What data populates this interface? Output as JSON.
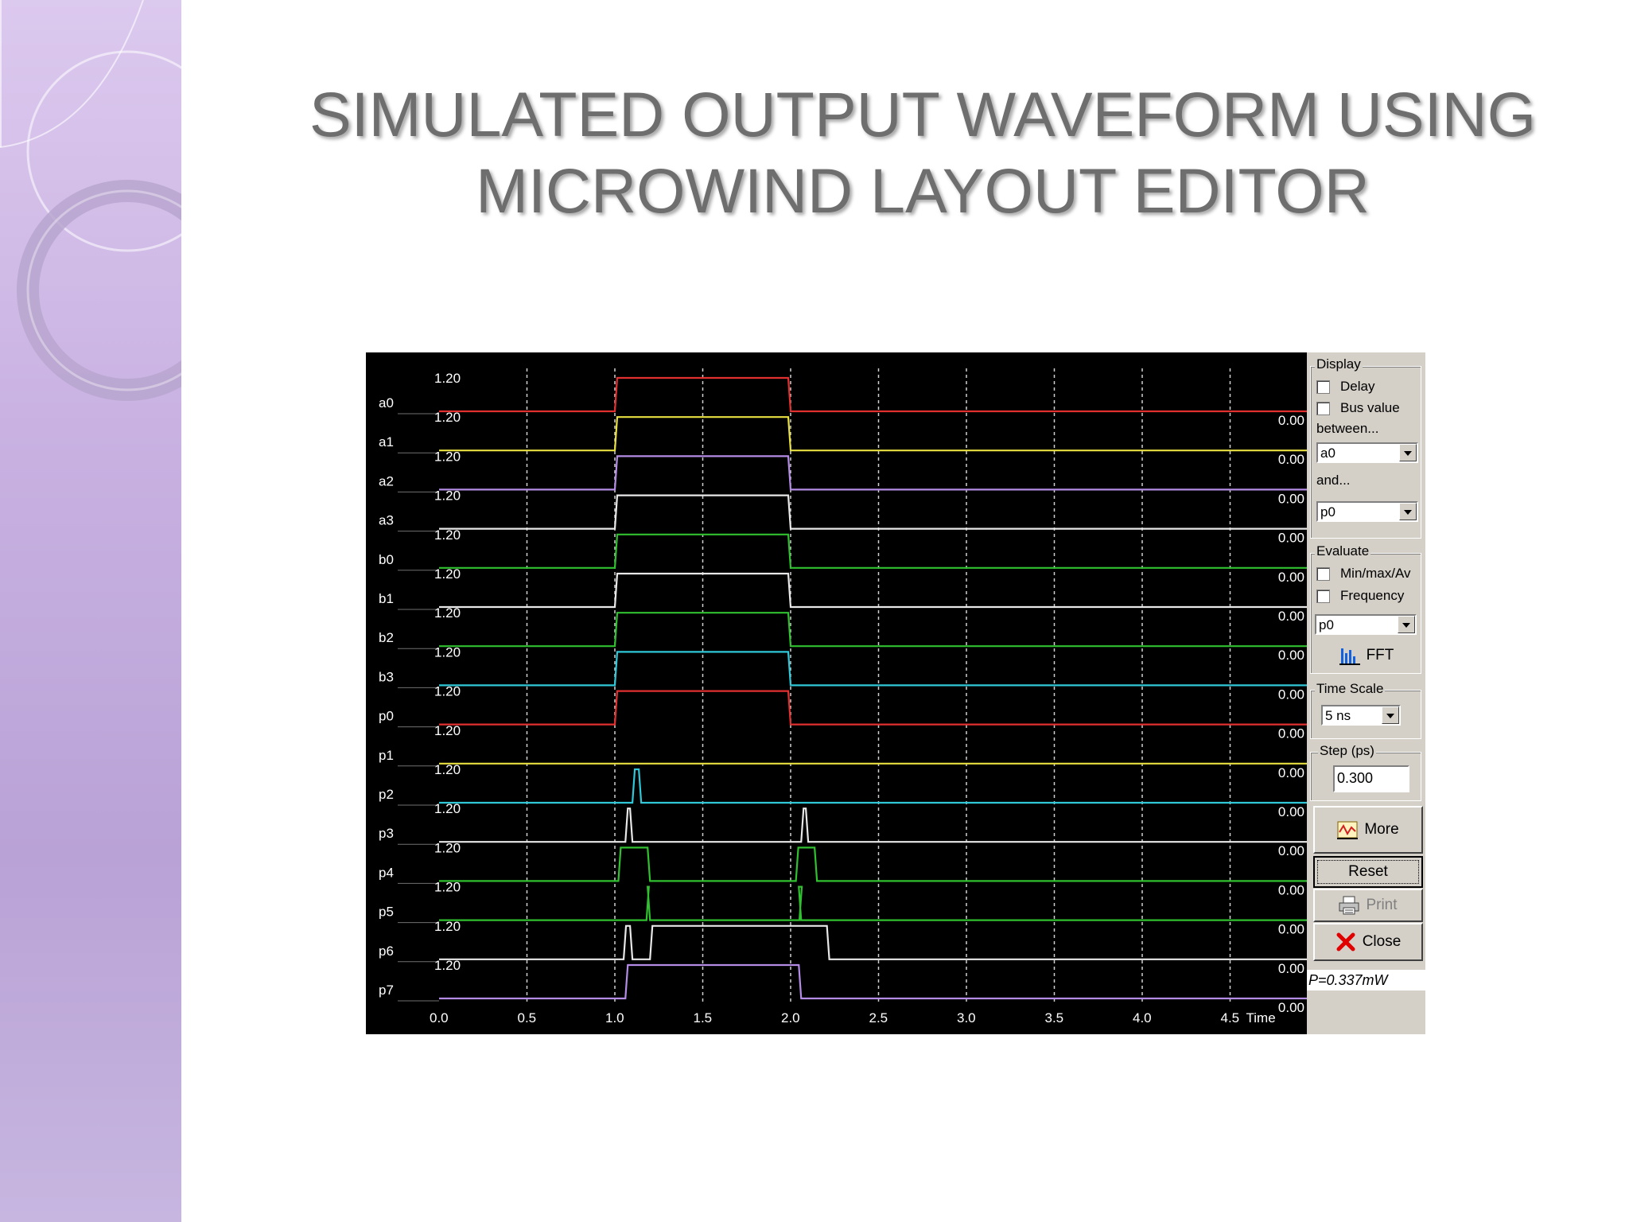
{
  "slide": {
    "title_line1": "SIMULATED OUTPUT WAVEFORM USING",
    "title_line2": "MICROWIND LAYOUT EDITOR"
  },
  "waveform": {
    "x_ticks": [
      "0.0",
      "0.5",
      "1.0",
      "1.5",
      "2.0",
      "2.5",
      "3.0",
      "3.5",
      "4.0",
      "4.5"
    ],
    "x_axis_suffix": "Time",
    "high_value": "1.20",
    "low_value": "0.00",
    "signals": [
      {
        "name": "a0",
        "color": "#e03030",
        "pulses": [
          [
            1.0,
            2.0
          ]
        ]
      },
      {
        "name": "a1",
        "color": "#e8e040",
        "pulses": [
          [
            1.0,
            2.0
          ]
        ]
      },
      {
        "name": "a2",
        "color": "#b48ce6",
        "pulses": [
          [
            1.0,
            2.0
          ]
        ]
      },
      {
        "name": "a3",
        "color": "#e8e8e8",
        "pulses": [
          [
            1.0,
            2.0
          ]
        ]
      },
      {
        "name": "b0",
        "color": "#30c030",
        "pulses": [
          [
            1.0,
            2.0
          ]
        ]
      },
      {
        "name": "b1",
        "color": "#e8e8e8",
        "pulses": [
          [
            1.0,
            2.0
          ]
        ]
      },
      {
        "name": "b2",
        "color": "#30c030",
        "pulses": [
          [
            1.0,
            2.0
          ]
        ]
      },
      {
        "name": "b3",
        "color": "#30c8d8",
        "pulses": [
          [
            1.0,
            2.0
          ]
        ]
      },
      {
        "name": "p0",
        "color": "#e03030",
        "pulses": [
          [
            1.0,
            2.0
          ]
        ]
      },
      {
        "name": "p1",
        "color": "#e8e040",
        "pulses": []
      },
      {
        "name": "p2",
        "color": "#30c8d8",
        "pulses": [
          [
            1.1,
            1.15
          ]
        ]
      },
      {
        "name": "p3",
        "color": "#e8e8e8",
        "pulses": [
          [
            1.06,
            1.1
          ],
          [
            2.06,
            2.1
          ]
        ]
      },
      {
        "name": "p4",
        "color": "#30c030",
        "pulses": [
          [
            1.02,
            1.2
          ],
          [
            2.03,
            2.15
          ]
        ]
      },
      {
        "name": "p5",
        "color": "#30c030",
        "pulses": [
          [
            1.18,
            1.2
          ],
          [
            2.05,
            2.06
          ]
        ]
      },
      {
        "name": "p6",
        "color": "#e8e8e8",
        "pulses": [
          [
            1.05,
            1.1
          ],
          [
            1.2,
            2.22
          ]
        ]
      },
      {
        "name": "p7",
        "color": "#b48ce6",
        "pulses": [
          [
            1.06,
            2.06
          ]
        ]
      }
    ]
  },
  "panel": {
    "display_label": "Display",
    "delay_label": "Delay",
    "bus_value_label": "Bus value",
    "between_label": "between...",
    "between_value": "a0",
    "and_label": "and...",
    "and_value": "p0",
    "evaluate_label": "Evaluate",
    "minmax_label": "Min/max/Av",
    "frequency_label": "Frequency",
    "evaluate_value": "p0",
    "fft_label": "FFT",
    "time_scale_label": "Time Scale",
    "time_scale_value": "5 ns",
    "step_label": "Step (ps)",
    "step_value": "0.300",
    "more_label": "More",
    "reset_label": "Reset",
    "print_label": "Print",
    "close_label": "Close",
    "power_text": "P=0.337mW"
  },
  "colors": {
    "title": "#6e6e6e",
    "grid": "#cfcfcf",
    "panel_bg": "#d4d0c8",
    "close_icon": "#e00000",
    "fft_icon": "#1060e0"
  }
}
